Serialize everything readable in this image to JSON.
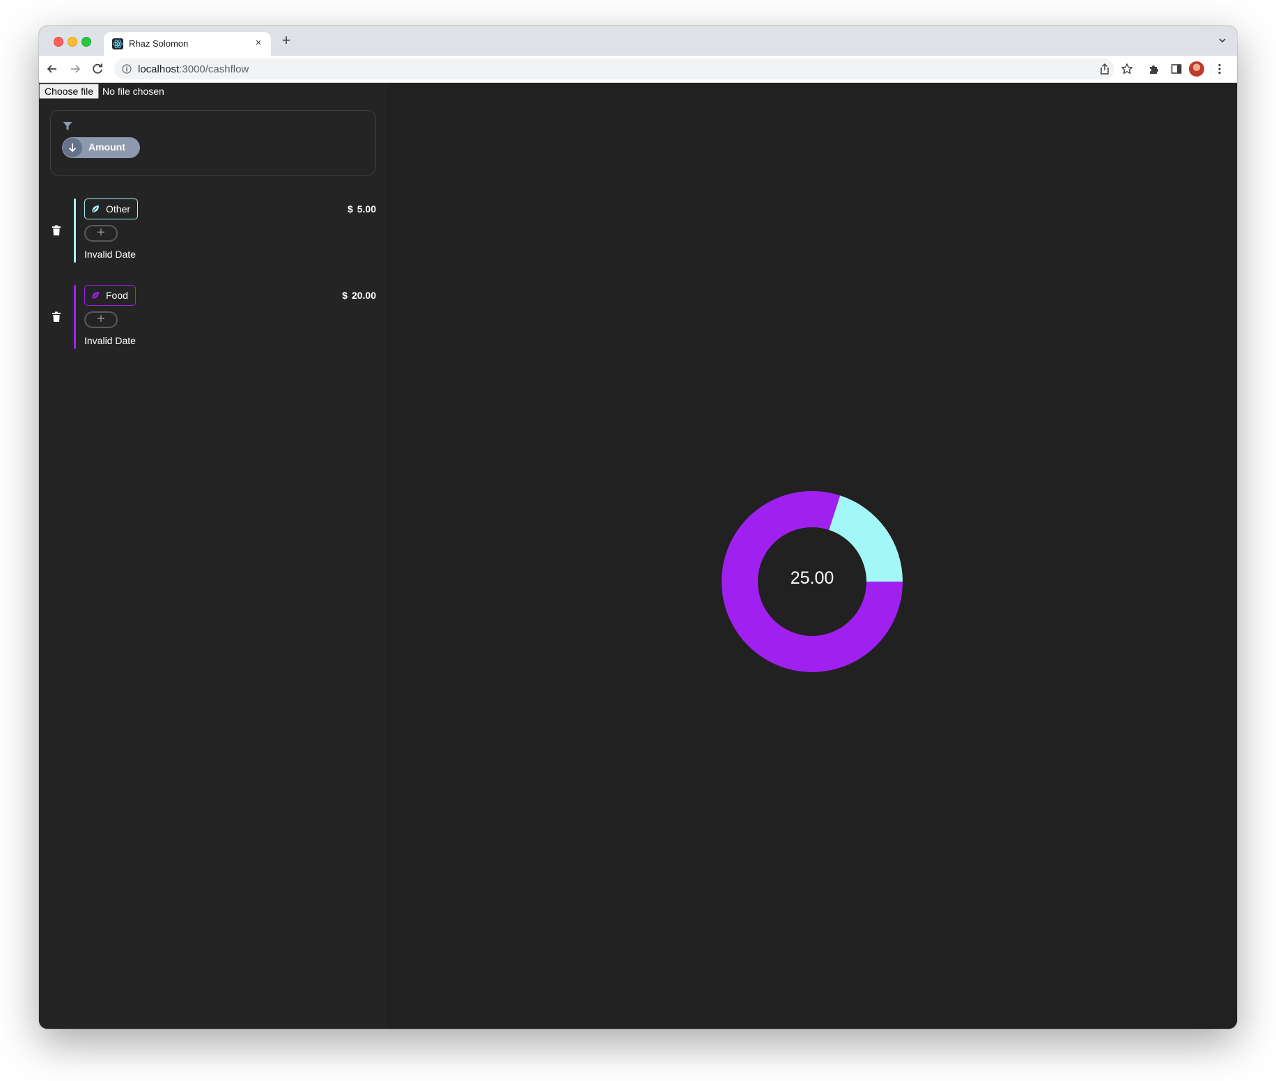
{
  "browser": {
    "tab_title": "Rhaz Solomon",
    "tab_close": "×",
    "new_tab": "+",
    "url_host": "localhost",
    "url_path": ":3000/cashflow"
  },
  "file_input": {
    "button_label": "Choose file",
    "status": "No file chosen"
  },
  "filter": {
    "sort_label": "Amount",
    "sort_direction": "descending"
  },
  "entries": [
    {
      "category": "Other",
      "color": "#a3f7f7",
      "currency": "$",
      "amount": "5.00",
      "add_label": "+",
      "date": "Invalid Date"
    },
    {
      "category": "Food",
      "color": "#a020f0",
      "currency": "$",
      "amount": "20.00",
      "add_label": "+",
      "date": "Invalid Date"
    }
  ],
  "chart_data": {
    "type": "pie",
    "variant": "donut",
    "center_label": "25.00",
    "slices": [
      {
        "label": "Other",
        "value": 5,
        "color": "#a3f7f7"
      },
      {
        "label": "Food",
        "value": 20,
        "color": "#a020f0"
      }
    ]
  }
}
